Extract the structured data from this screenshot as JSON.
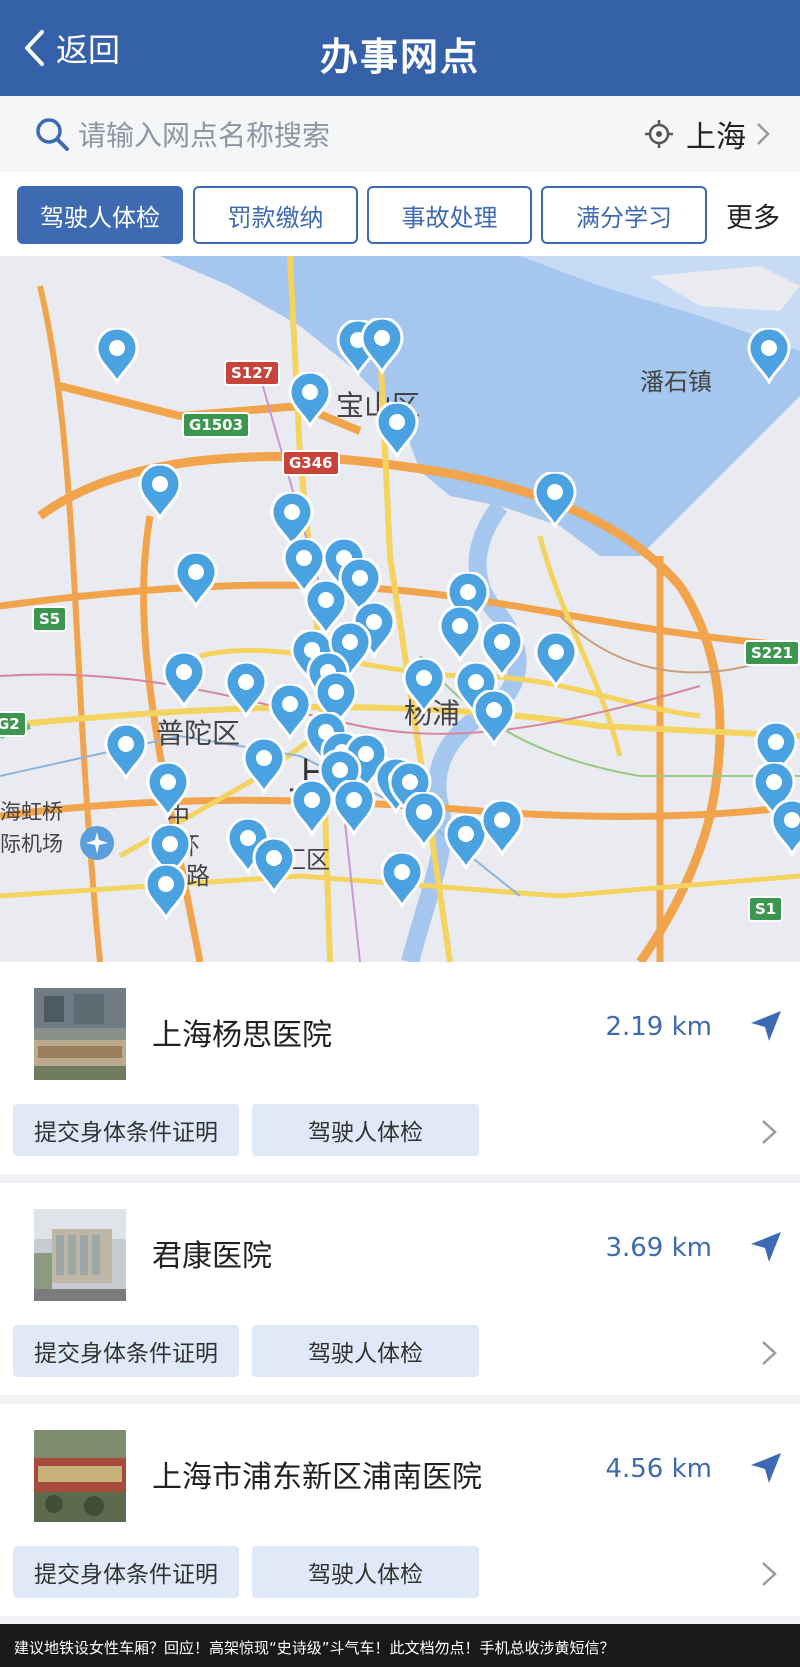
{
  "header": {
    "back_label": "返回",
    "title": "办事网点"
  },
  "search": {
    "placeholder": "请输入网点名称搜索",
    "city": "上海"
  },
  "tabs": [
    {
      "label": "驾驶人体检",
      "active": true
    },
    {
      "label": "罚款缴纳",
      "active": false
    },
    {
      "label": "事故处理",
      "active": false
    },
    {
      "label": "满分学习",
      "active": false
    }
  ],
  "tabs_more": "更多",
  "map": {
    "labels": {
      "baoshan": "宝山区",
      "panshi": "潘石镇",
      "putuo": "普陀区",
      "yangpu": "杨浦",
      "shanghai": "上海",
      "hongqiao_1": "海虹桥",
      "hongqiao_2": "际机场",
      "road_1": "中",
      "road_2": "环",
      "road_3": "路",
      "district_partial": "徐汇区"
    },
    "shields": {
      "s127": "S127",
      "g1503": "G1503",
      "g346": "G346",
      "s5": "S5",
      "s221": "S221",
      "g2": "G2",
      "s1": "S1"
    }
  },
  "results": [
    {
      "name": "上海杨思医院",
      "distance": "2.19 km",
      "tags": [
        "提交身体条件证明",
        "驾驶人体检"
      ]
    },
    {
      "name": "君康医院",
      "distance": "3.69 km",
      "tags": [
        "提交身体条件证明",
        "驾驶人体检"
      ]
    },
    {
      "name": "上海市浦东新区浦南医院",
      "distance": "4.56 km",
      "tags": [
        "提交身体条件证明",
        "驾驶人体检"
      ]
    }
  ],
  "news_ticker": "建议地铁设女性车厢？回应！高架惊现“史诗级”斗气车！此文档勿点！手机总收涉黄短信？",
  "colors": {
    "primary": "#3561a9",
    "pin": "#4aa3e0",
    "chip_bg": "#dfe9f7"
  }
}
